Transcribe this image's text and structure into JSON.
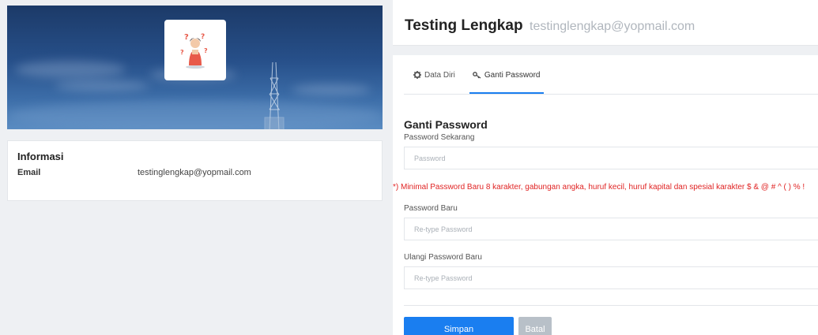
{
  "profile": {
    "name": "Testing Lengkap",
    "email": "testinglengkap@yopmail.com"
  },
  "info": {
    "title": "Informasi",
    "email_label": "Email",
    "email_value": "testinglengkap@yopmail.com"
  },
  "tabs": [
    {
      "label": "Data Diri",
      "icon": "gear-icon",
      "active": false
    },
    {
      "label": "Ganti Password",
      "icon": "key-icon",
      "active": true
    }
  ],
  "form": {
    "title": "Ganti Password",
    "current_label": "Password Sekarang",
    "current_placeholder": "Password",
    "warning": "*) Minimal Password Baru 8 karakter, gabungan angka, huruf kecil, huruf kapital dan spesial karakter $ & @ # ^ ( ) % !",
    "new_label": "Password Baru",
    "new_placeholder": "Re-type Password",
    "repeat_label": "Ulangi Password Baru",
    "repeat_placeholder": "Re-type Password",
    "save_label": "Simpan",
    "cancel_label": "Batal"
  },
  "colors": {
    "primary": "#1a7ef0",
    "warning": "#e02424",
    "cancel": "#b8c0c8"
  }
}
